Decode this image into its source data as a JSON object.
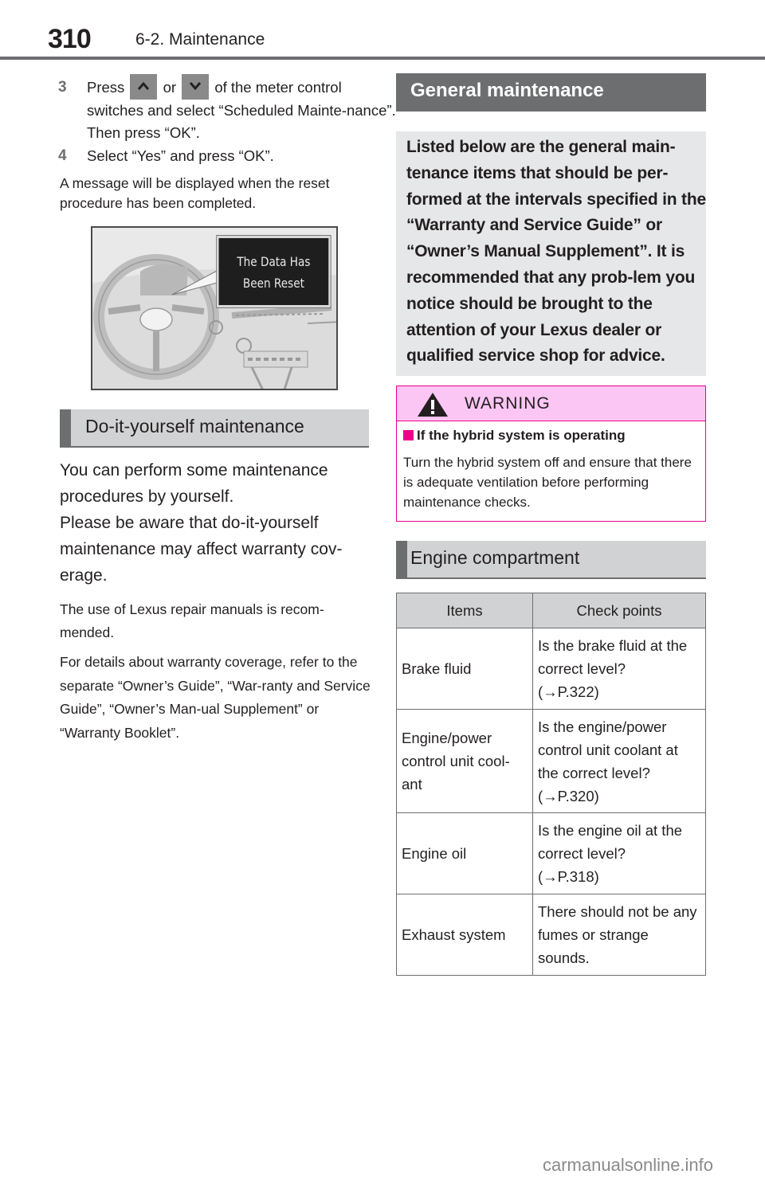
{
  "header": {
    "page_number": "310",
    "section_title": "6-2. Maintenance"
  },
  "steps": [
    {
      "number": "3",
      "text_before_up": "Press",
      "up_key_icon": "chevron-up-icon",
      "text_between": "or",
      "down_key_icon": "chevron-down-icon",
      "text_after": "of the meter control switches and select “Scheduled Mainte-nance”. Then press “OK”."
    },
    {
      "number": "4",
      "text": "Select “Yes” and press “OK”."
    }
  ],
  "reset_note": "A message will be displayed when the reset procedure has been completed.",
  "illustration": {
    "display_line1": "The Data Has",
    "display_line2": "Been Reset"
  },
  "diy_section": {
    "heading": "Do-it-yourself maintenance",
    "lead": "You can perform some maintenance procedures by yourself.",
    "lead2": "Please be aware that do-it-yourself maintenance may affect warranty cov-erage.",
    "note1": "The use of Lexus repair manuals is recom-mended.",
    "note2": "For details about warranty coverage, refer to the separate “Owner’s Guide”, “War-ranty and Service Guide”, “Owner’s Man-ual Supplement” or “Warranty Booklet”."
  },
  "general_section": {
    "heading": "General maintenance",
    "callout": "Listed below are the general main-tenance items that should be per-formed at the intervals specified in the “Warranty and Service Guide” or “Owner’s Manual Supplement”. It is recommended that any prob-lem you notice should be brought to the attention of your Lexus dealer or qualified service shop for advice."
  },
  "warning": {
    "label": "WARNING",
    "subheading": "If the hybrid system is operating",
    "body": "Turn the hybrid system off and ensure that there is adequate ventilation before performing maintenance checks.",
    "accent_color": "#ec008c"
  },
  "engine_section": {
    "heading": "Engine compartment",
    "table": {
      "columns": [
        "Items",
        "Check points"
      ],
      "rows": [
        {
          "item": "Brake fluid",
          "check": "Is the brake fluid at the correct level?",
          "ref": "(→P.322)"
        },
        {
          "item": "Engine/power control unit cool-ant",
          "check": "Is the engine/power control unit coolant at the correct level?",
          "ref": "(→P.320)"
        },
        {
          "item": "Engine oil",
          "check": "Is the engine oil at the correct level?",
          "ref": "(→P.318)"
        },
        {
          "item": "Exhaust system",
          "check": "There should not be any fumes or strange sounds.",
          "ref": ""
        }
      ]
    }
  },
  "watermark": "carmanualsonline.info"
}
